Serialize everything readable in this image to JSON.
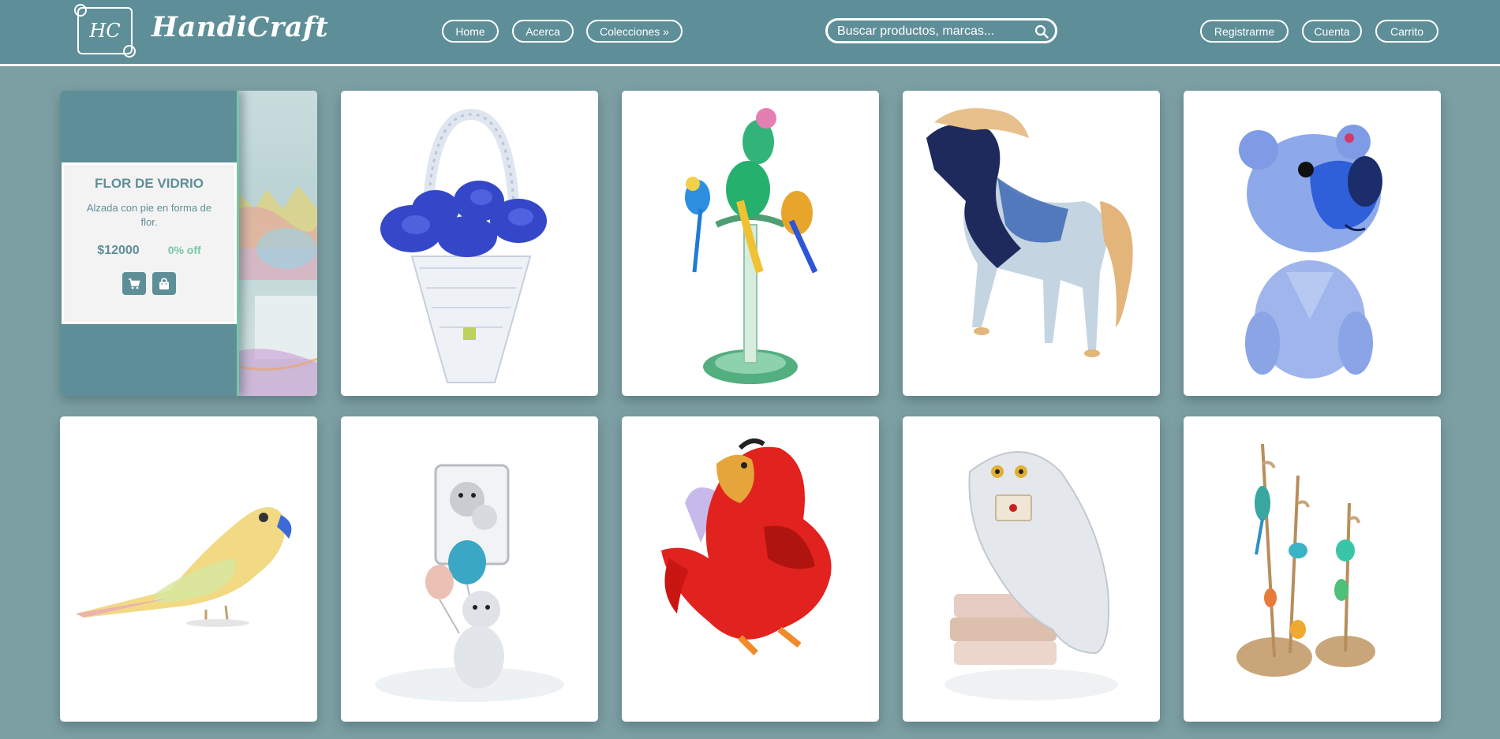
{
  "header": {
    "brand": "HandiCraft",
    "logo_text": "HC",
    "nav": {
      "home": "Home",
      "about": "Acerca",
      "collections": "Colecciones »"
    },
    "search": {
      "placeholder": "Buscar productos, marcas..."
    },
    "account": {
      "register": "Registrarme",
      "account": "Cuenta",
      "cart": "Carrito"
    }
  },
  "featured": {
    "title": "FLOR DE VIDRIO",
    "description": "Alzada con pie en forma de flor.",
    "price": "$12000",
    "discount": "0% off"
  },
  "colors": {
    "primary": "#5e8f98",
    "background": "#7c9fa3",
    "accent": "#79c6a5",
    "card": "#ffffff"
  },
  "products": [
    {
      "art": "crystal-flower-basket"
    },
    {
      "art": "glass-parrots-perch"
    },
    {
      "art": "blue-glass-horse"
    },
    {
      "art": "blue-crystal-bear"
    },
    {
      "art": "crystal-parakeet"
    },
    {
      "art": "crystal-bear-balloon"
    },
    {
      "art": "red-crystal-parrot"
    },
    {
      "art": "crystal-owl-books"
    },
    {
      "art": "crystal-birds-stand"
    }
  ]
}
